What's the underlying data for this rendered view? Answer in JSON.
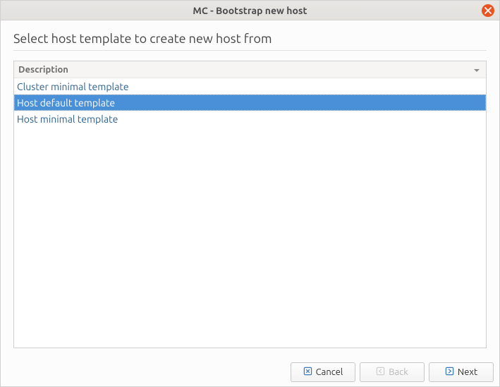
{
  "window": {
    "title": "MC - Bootstrap new host"
  },
  "main": {
    "heading": "Select host template to create new host from",
    "table": {
      "header": "Description",
      "rows": [
        {
          "label": "Cluster minimal template",
          "selected": false
        },
        {
          "label": "Host default template",
          "selected": true
        },
        {
          "label": "Host minimal template",
          "selected": false
        }
      ]
    }
  },
  "buttons": {
    "cancel": "Cancel",
    "back": "Back",
    "next": "Next"
  },
  "colors": {
    "accent": "#e95420",
    "selection": "#4a90d9",
    "link": "#2c6090"
  }
}
